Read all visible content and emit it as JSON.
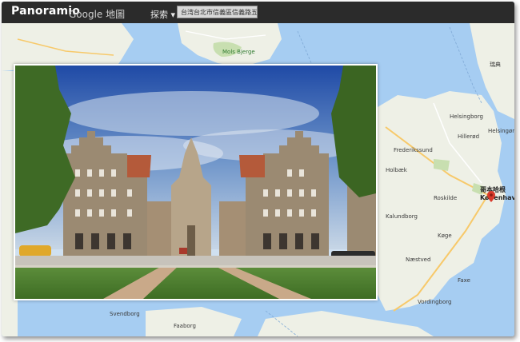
{
  "app": {
    "logo_text": "Panoramio",
    "maps_label": "Google 地圖",
    "explore_label": "探索 ▾",
    "search_value": "台湾台北市信義區信義路五段台北",
    "colors": {
      "topbar": "#2b2b2b",
      "sea": "#a6cdf2",
      "land": "#eef0e6",
      "park": "#c8dfb0",
      "pin": "#d93a2b"
    }
  },
  "map": {
    "pin_icon": "map-pin-icon",
    "labels": {
      "sweden_region": "瑞典",
      "helsinki_region": "Helsingør",
      "capital_zh": "哥本哈根",
      "capital": "København",
      "hillerod": "Hillerød",
      "roskilde": "Roskilde",
      "frederikssund": "Frederikssund",
      "koge": "Køge",
      "naestved": "Næstved",
      "faxe": "Faxe",
      "vordingborg": "Vordingborg",
      "faaborg": "Faaborg",
      "helsingborg": "Helsingborg",
      "holbaek": "Holbæk",
      "kalundborg": "Kalundborg",
      "svendborg": "Svendborg",
      "park": "Mols Bjerge"
    }
  }
}
